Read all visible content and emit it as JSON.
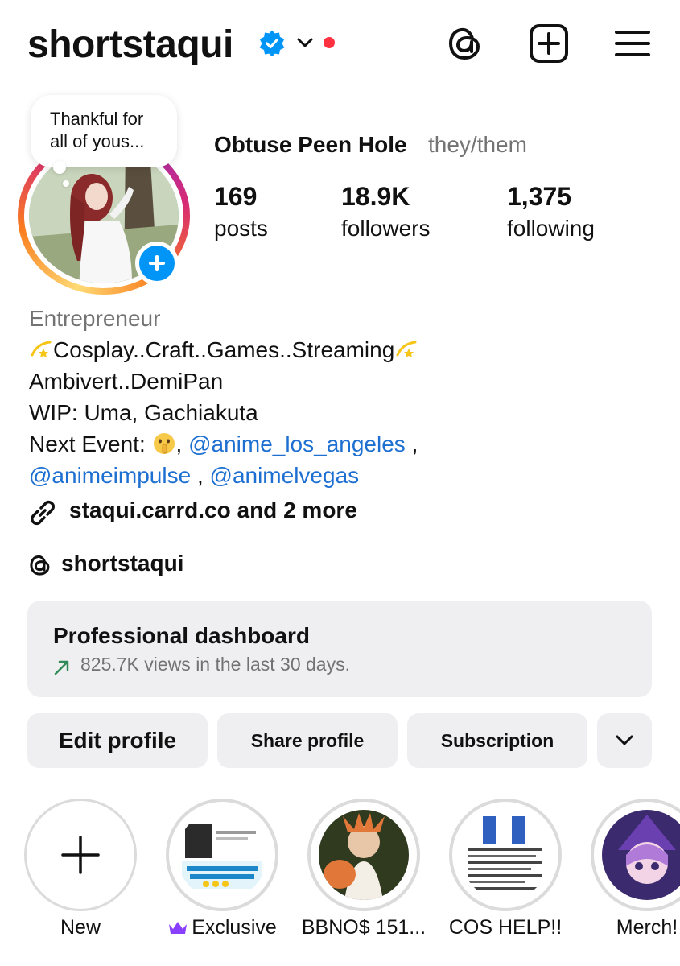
{
  "header": {
    "username": "shortstaqui",
    "icons": [
      "verified-badge-icon",
      "chevron-down-icon",
      "notification-dot",
      "threads-icon",
      "create-post-icon",
      "menu-icon"
    ]
  },
  "note": {
    "text": "Thankful for all of yous..."
  },
  "profile": {
    "display_name": "Obtuse Peen Hole",
    "pronouns": "they/them",
    "stats": {
      "posts": {
        "value": "169",
        "label": "posts"
      },
      "followers": {
        "value": "18.9K",
        "label": "followers"
      },
      "following": {
        "value": "1,375",
        "label": "following"
      }
    }
  },
  "bio": {
    "category": "Entrepreneur",
    "line1": "Cosplay..Craft..Games..Streaming",
    "line2": "Ambivert..DemiPan",
    "line3": "WIP: Uma, Gachiakuta",
    "line4_prefix": "Next Event: ",
    "line4_sep": ", ",
    "mention1": "@anime_los_angeles",
    "line4_suffix": " ,",
    "mention2": "@animeimpulse",
    "line5_sep": " , ",
    "mention3": "@animelvegas",
    "link": "staqui.carrd.co and 2 more",
    "threads_handle": "shortstaqui"
  },
  "dashboard": {
    "title": "Professional dashboard",
    "subtitle": "825.7K views in the last 30 days."
  },
  "actions": {
    "edit": "Edit profile",
    "share": "Share profile",
    "subscription": "Subscription"
  },
  "highlights": [
    {
      "label": "New"
    },
    {
      "label": "Exclusive"
    },
    {
      "label": "BBNO$ 151..."
    },
    {
      "label": "COS HELP!!"
    },
    {
      "label": "Merch!"
    }
  ],
  "colors": {
    "mention": "#1d6fd1",
    "verified": "#0095f6",
    "notification": "#ff3040",
    "trend_arrow": "#2e8b57",
    "crown": "#8a3ffc"
  }
}
